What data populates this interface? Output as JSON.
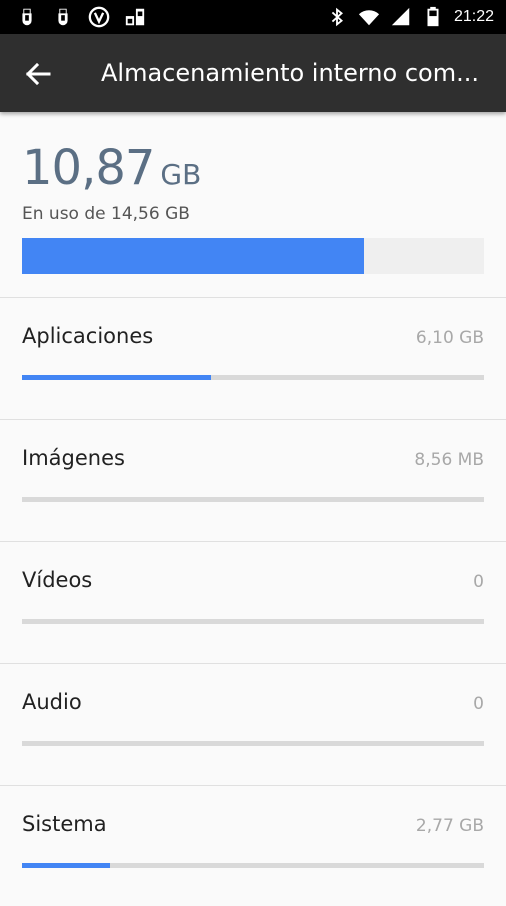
{
  "status_bar": {
    "time": "21:22",
    "left_icons": [
      "usb-icon",
      "usb-icon",
      "vpn-icon",
      "network-icon"
    ],
    "right_icons": [
      "bluetooth-icon",
      "wifi-icon",
      "signal-icon",
      "battery-icon"
    ]
  },
  "app_bar": {
    "title": "Almacenamiento interno com..."
  },
  "summary": {
    "used_value": "10,87",
    "used_unit": "GB",
    "used_of": "En uso de 14,56 GB",
    "used_fraction": 0.74
  },
  "categories": [
    {
      "label": "Aplicaciones",
      "size": "6,10 GB",
      "fraction": 0.41
    },
    {
      "label": "Imágenes",
      "size": "8,56 MB",
      "fraction": 0.0
    },
    {
      "label": "Vídeos",
      "size": "0",
      "fraction": 0.0
    },
    {
      "label": "Audio",
      "size": "0",
      "fraction": 0.0
    },
    {
      "label": "Sistema",
      "size": "2,77 GB",
      "fraction": 0.19
    }
  ],
  "colors": {
    "accent": "#4285f4",
    "app_bar": "#2f2f2f",
    "used_text": "#5b6f84"
  }
}
